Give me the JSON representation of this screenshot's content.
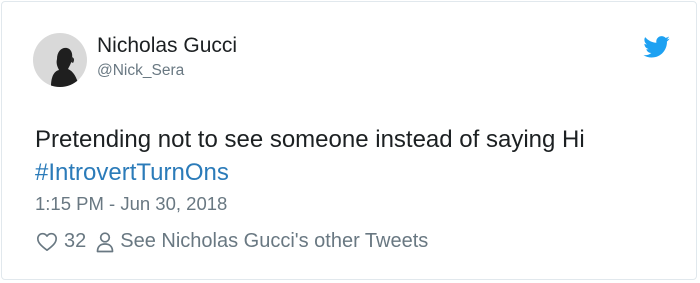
{
  "tweet": {
    "author_name": "Nicholas Gucci",
    "author_handle": "@Nick_Sera",
    "text": "Pretending not to see someone instead of saying Hi",
    "hashtag": "#IntrovertTurnOns",
    "timestamp": "1:15 PM - Jun 30, 2018",
    "like_count": "32",
    "other_tweets_label": "See Nicholas Gucci's other Tweets"
  },
  "icons": {
    "brand": "twitter-bird-icon",
    "like": "heart-icon",
    "profile": "person-icon"
  },
  "colors": {
    "text": "#1c2022",
    "secondary": "#697882",
    "link": "#2b7bb9",
    "twitter_blue": "#1da1f2",
    "border": "#e1e8ed"
  }
}
